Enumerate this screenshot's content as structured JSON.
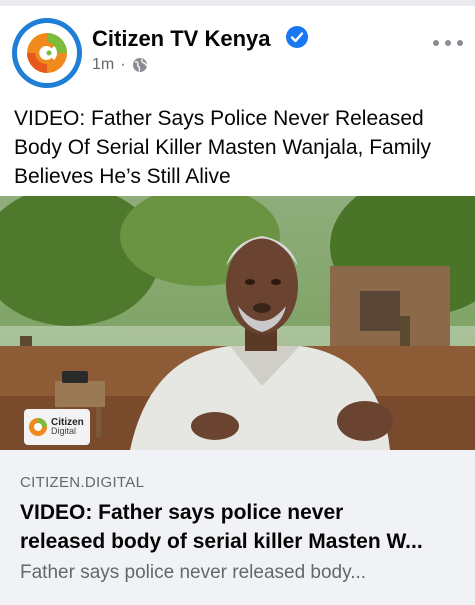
{
  "post": {
    "page_name": "Citizen TV Kenya",
    "time": "1m",
    "separator": "·",
    "privacy_icon": "globe-icon",
    "verified_icon": "verified-badge-icon",
    "more_icon": "more-options-icon",
    "text": "VIDEO: Father Says Police Never Released Body Of Serial Killer Masten Wanjala, Family Believes He’s Still Alive"
  },
  "media": {
    "watermark_line1": "Citizen",
    "watermark_line2": "Digital"
  },
  "link_preview": {
    "domain": "CITIZEN.DIGITAL",
    "title_line1": "VIDEO: Father says police never",
    "title_line2": "released body of serial killer Masten W...",
    "description": "Father says police never released body..."
  },
  "colors": {
    "brand_blue": "#1f7fd6",
    "brand_orange": "#f08a1c",
    "brand_green": "#7dbb3a",
    "verified_blue": "#1877f2",
    "secondary_text": "#65676b",
    "card_bg": "#f0f2f5"
  }
}
